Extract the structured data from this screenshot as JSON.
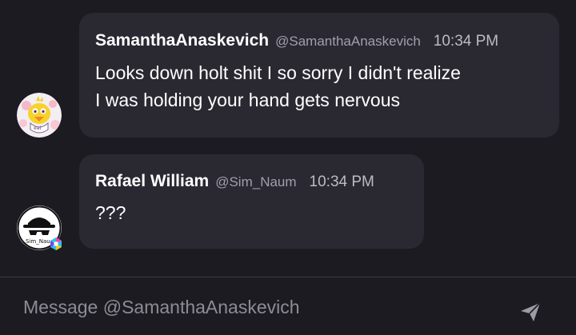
{
  "messages": [
    {
      "name": "SamanthaAnaskevich",
      "handle": "@SamanthaAnaskevich",
      "time": "10:34 PM",
      "text_lines": [
        "Looks down holt shit I so sorry I didn't realize",
        "I was holding your hand gets nervous"
      ],
      "avatar_icon": "chica-plush-avatar-icon"
    },
    {
      "name": "Rafael William",
      "handle": "@Sim_Naum",
      "time": "10:34 PM",
      "text_lines": [
        "???"
      ],
      "avatar_icon": "hat-sunglasses-avatar-icon",
      "avatar_label": "Sim_Nau"
    }
  ],
  "composer": {
    "placeholder": "Message @SamanthaAnaskevich",
    "send_icon": "paper-plane-send-icon"
  },
  "colors": {
    "background": "#1d1b22",
    "bubble": "#2a2831",
    "text": "#ffffff",
    "muted": "#a29fab",
    "placeholder": "#8e8b96"
  }
}
